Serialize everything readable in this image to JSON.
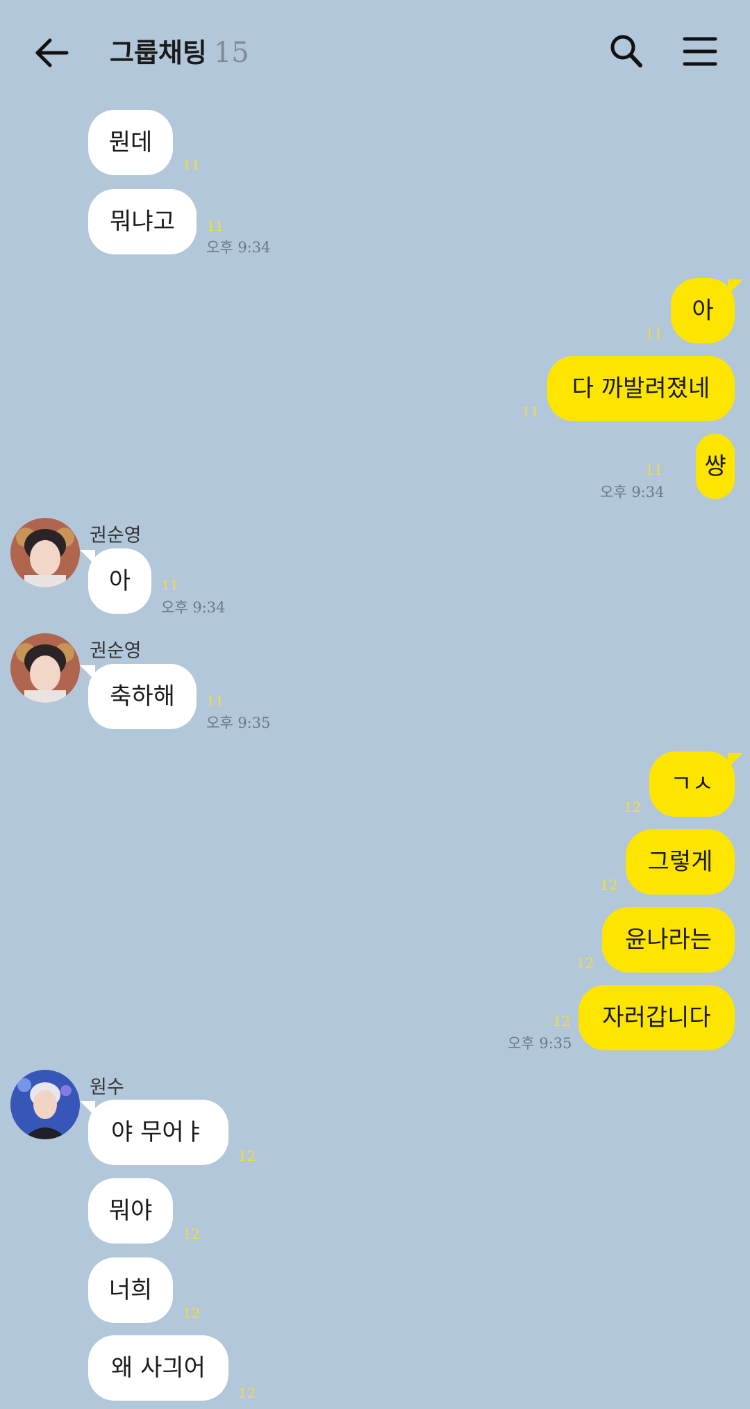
{
  "header": {
    "title": "그룹채팅",
    "member_count": "15",
    "back_icon": "arrow-left-icon",
    "search_icon": "search-icon",
    "menu_icon": "hamburger-menu-icon"
  },
  "colors": {
    "background": "#b2c7da",
    "my_bubble": "#fee500",
    "other_bubble": "#ffffff",
    "unread": "#f4dd3a"
  },
  "messages": [
    {
      "text": "뭔데",
      "unread": "11"
    },
    {
      "text": "뭐냐고",
      "unread": "11",
      "time": "오후 9:34"
    },
    {
      "text": "아",
      "unread": "11"
    },
    {
      "text": "다 까발려졌네",
      "unread": "11"
    },
    {
      "text": "썅",
      "unread": "11",
      "time": "오후 9:34"
    },
    {
      "sender": "권순영",
      "text": "아",
      "unread": "11",
      "time": "오후 9:34"
    },
    {
      "sender": "권순영",
      "text": "축하해",
      "unread": "11",
      "time": "오후 9:35"
    },
    {
      "text": "ㄱㅅ",
      "unread": "12"
    },
    {
      "text": "그렇게",
      "unread": "12"
    },
    {
      "text": "윤나라는",
      "unread": "12"
    },
    {
      "text": "자러갑니다",
      "unread": "12",
      "time": "오후 9:35"
    },
    {
      "sender": "원수",
      "text": "야 무어ㅑ",
      "unread": "12"
    },
    {
      "text": "뭐야",
      "unread": "12"
    },
    {
      "text": "너희",
      "unread": "12"
    },
    {
      "text": "왜 사긔어",
      "unread": "12"
    }
  ]
}
